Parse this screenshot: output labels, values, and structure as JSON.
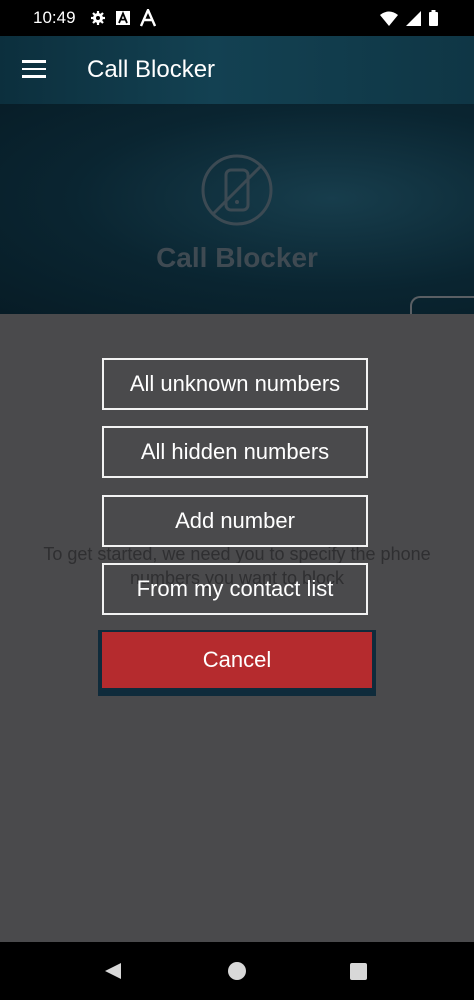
{
  "status_bar": {
    "time": "10:49"
  },
  "app_bar": {
    "title": "Call Blocker"
  },
  "hero": {
    "title": "Call Blocker"
  },
  "main": {
    "intro_text": "To get started, we need you to specify the phone numbers you want to block"
  },
  "dialog": {
    "options": [
      {
        "label": "All unknown numbers"
      },
      {
        "label": "All hidden numbers"
      },
      {
        "label": "Add number"
      },
      {
        "label": "From my contact list"
      }
    ],
    "cancel_label": "Cancel"
  },
  "colors": {
    "app_bar": "#134152",
    "cancel_button": "#b52b2e",
    "scrim": "#4a4a4c"
  },
  "icons": [
    "settings-icon",
    "a-badge-icon",
    "a-letter-icon",
    "wifi-icon",
    "signal-icon",
    "battery-icon",
    "menu-icon",
    "blocked-phone-icon",
    "back-icon",
    "home-icon",
    "recents-icon"
  ]
}
